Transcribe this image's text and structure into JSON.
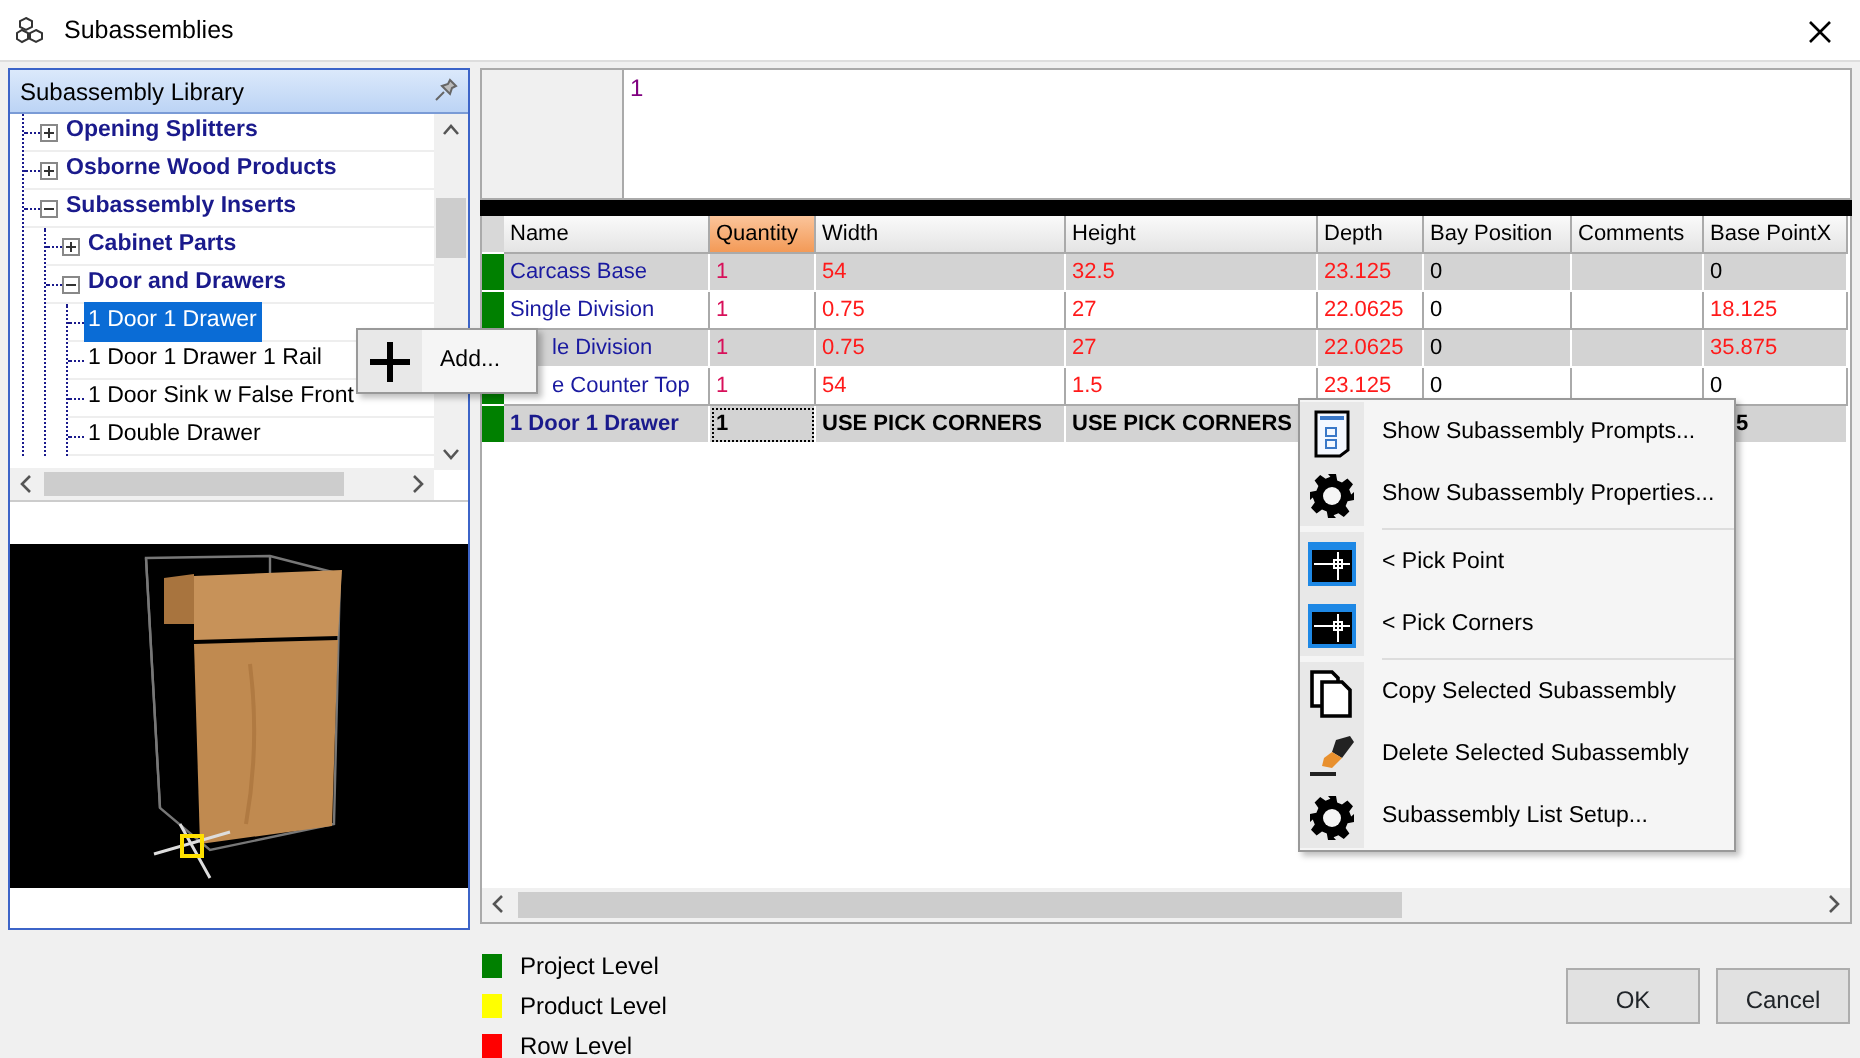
{
  "window": {
    "title": "Subassemblies"
  },
  "library": {
    "title": "Subassembly Library",
    "tree": [
      {
        "label": "Opening Splitters",
        "kind": "folder",
        "expanded": false
      },
      {
        "label": "Osborne Wood Products",
        "kind": "folder",
        "expanded": false
      },
      {
        "label": "Subassembly Inserts",
        "kind": "folder",
        "expanded": true,
        "children": [
          {
            "label": "Cabinet Parts",
            "kind": "folder",
            "expanded": false
          },
          {
            "label": "Door and Drawers",
            "kind": "folder",
            "expanded": true,
            "children": [
              {
                "label": "1 Door 1 Drawer",
                "kind": "item",
                "selected": true
              },
              {
                "label": "1 Door 1 Drawer 1 Rail",
                "kind": "item",
                "selected": false
              },
              {
                "label": "1 Door Sink w False Front",
                "kind": "item",
                "selected": false
              },
              {
                "label": "1 Double Drawer",
                "kind": "item",
                "selected": false
              }
            ]
          }
        ]
      }
    ]
  },
  "quantity_box": {
    "value": "1"
  },
  "grid": {
    "columns": [
      {
        "label": "Name",
        "selected": false
      },
      {
        "label": "Quantity",
        "selected": true
      },
      {
        "label": "Width",
        "selected": false
      },
      {
        "label": "Height",
        "selected": false
      },
      {
        "label": "Depth",
        "selected": false
      },
      {
        "label": "Bay Position",
        "selected": false
      },
      {
        "label": "Comments",
        "selected": false
      },
      {
        "label": "Base PointX",
        "selected": false
      }
    ],
    "rows": [
      {
        "selected": false,
        "color": "#008000",
        "cells": [
          {
            "text": "Carcass Base",
            "kind": "name"
          },
          {
            "text": "1",
            "kind": "qty"
          },
          {
            "text": "54",
            "kind": "row"
          },
          {
            "text": "32.5",
            "kind": "row"
          },
          {
            "text": "23.125",
            "kind": "row"
          },
          {
            "text": "0",
            "kind": "plain"
          },
          {
            "kind": "empty"
          },
          {
            "text": "0",
            "kind": "plain"
          }
        ]
      },
      {
        "selected": false,
        "color": "#008000",
        "cells": [
          {
            "text": "Single Division",
            "kind": "name"
          },
          {
            "text": "1",
            "kind": "qty"
          },
          {
            "text": "0.75",
            "kind": "row"
          },
          {
            "text": "27",
            "kind": "row"
          },
          {
            "text": "22.0625",
            "kind": "row"
          },
          {
            "text": "0",
            "kind": "plain"
          },
          {
            "kind": "empty"
          },
          {
            "text": "18.125",
            "kind": "row"
          }
        ]
      },
      {
        "selected": false,
        "cells": [
          {
            "text": "le Division",
            "kind": "name",
            "covered": true
          },
          {
            "text": "1",
            "kind": "qty"
          },
          {
            "text": "0.75",
            "kind": "row"
          },
          {
            "text": "27",
            "kind": "row"
          },
          {
            "text": "22.0625",
            "kind": "row"
          },
          {
            "text": "0",
            "kind": "plain"
          },
          {
            "kind": "empty"
          },
          {
            "text": "35.875",
            "kind": "row"
          }
        ]
      },
      {
        "selected": false,
        "color": "#008000",
        "cells": [
          {
            "text": "e Counter Top",
            "kind": "name",
            "covered": true
          },
          {
            "text": "1",
            "kind": "qty"
          },
          {
            "text": "54",
            "kind": "row"
          },
          {
            "text": "1.5",
            "kind": "row"
          },
          {
            "text": "23.125",
            "kind": "row"
          },
          {
            "text": "0",
            "kind": "plain"
          },
          {
            "kind": "empty"
          },
          {
            "text": "0",
            "kind": "plain"
          }
        ]
      },
      {
        "selected": true,
        "color": "#008000",
        "cells": [
          {
            "text": "1 Door 1 Drawer",
            "kind": "name"
          },
          {
            "text": "1",
            "kind": "qty"
          },
          {
            "text": "USE PICK CORNERS",
            "kind": "plain"
          },
          {
            "text": "USE PICK CORNERS",
            "kind": "plain"
          },
          {
            "kind": "hidden"
          },
          {
            "kind": "hidden"
          },
          {
            "kind": "hidden"
          },
          {
            "text": "5",
            "kind": "plain",
            "covered": true
          }
        ]
      }
    ]
  },
  "add_menu": {
    "items": [
      {
        "label": "Add...",
        "kind": "add"
      }
    ]
  },
  "context_menu": {
    "items": [
      {
        "label": "Show Subassembly Prompts...",
        "kind": "prompts"
      },
      {
        "label": "Show Subassembly Properties...",
        "kind": "settings"
      },
      {
        "kind": "separator"
      },
      {
        "label": "< Pick Point",
        "kind": "pick"
      },
      {
        "label": "< Pick Corners",
        "kind": "pick"
      },
      {
        "kind": "separator"
      },
      {
        "label": "Copy Selected Subassembly",
        "kind": "copy"
      },
      {
        "label": "Delete Selected Subassembly",
        "kind": "erase"
      },
      {
        "label": "Subassembly List Setup...",
        "kind": "settings"
      }
    ]
  },
  "legend": [
    {
      "label": "Project Level",
      "color": "#008000"
    },
    {
      "label": "Product Level",
      "color": "#ffff00"
    },
    {
      "label": "Row Level",
      "color": "#ff0000"
    }
  ],
  "buttons": [
    {
      "label": "OK"
    },
    {
      "label": "Cancel"
    }
  ]
}
